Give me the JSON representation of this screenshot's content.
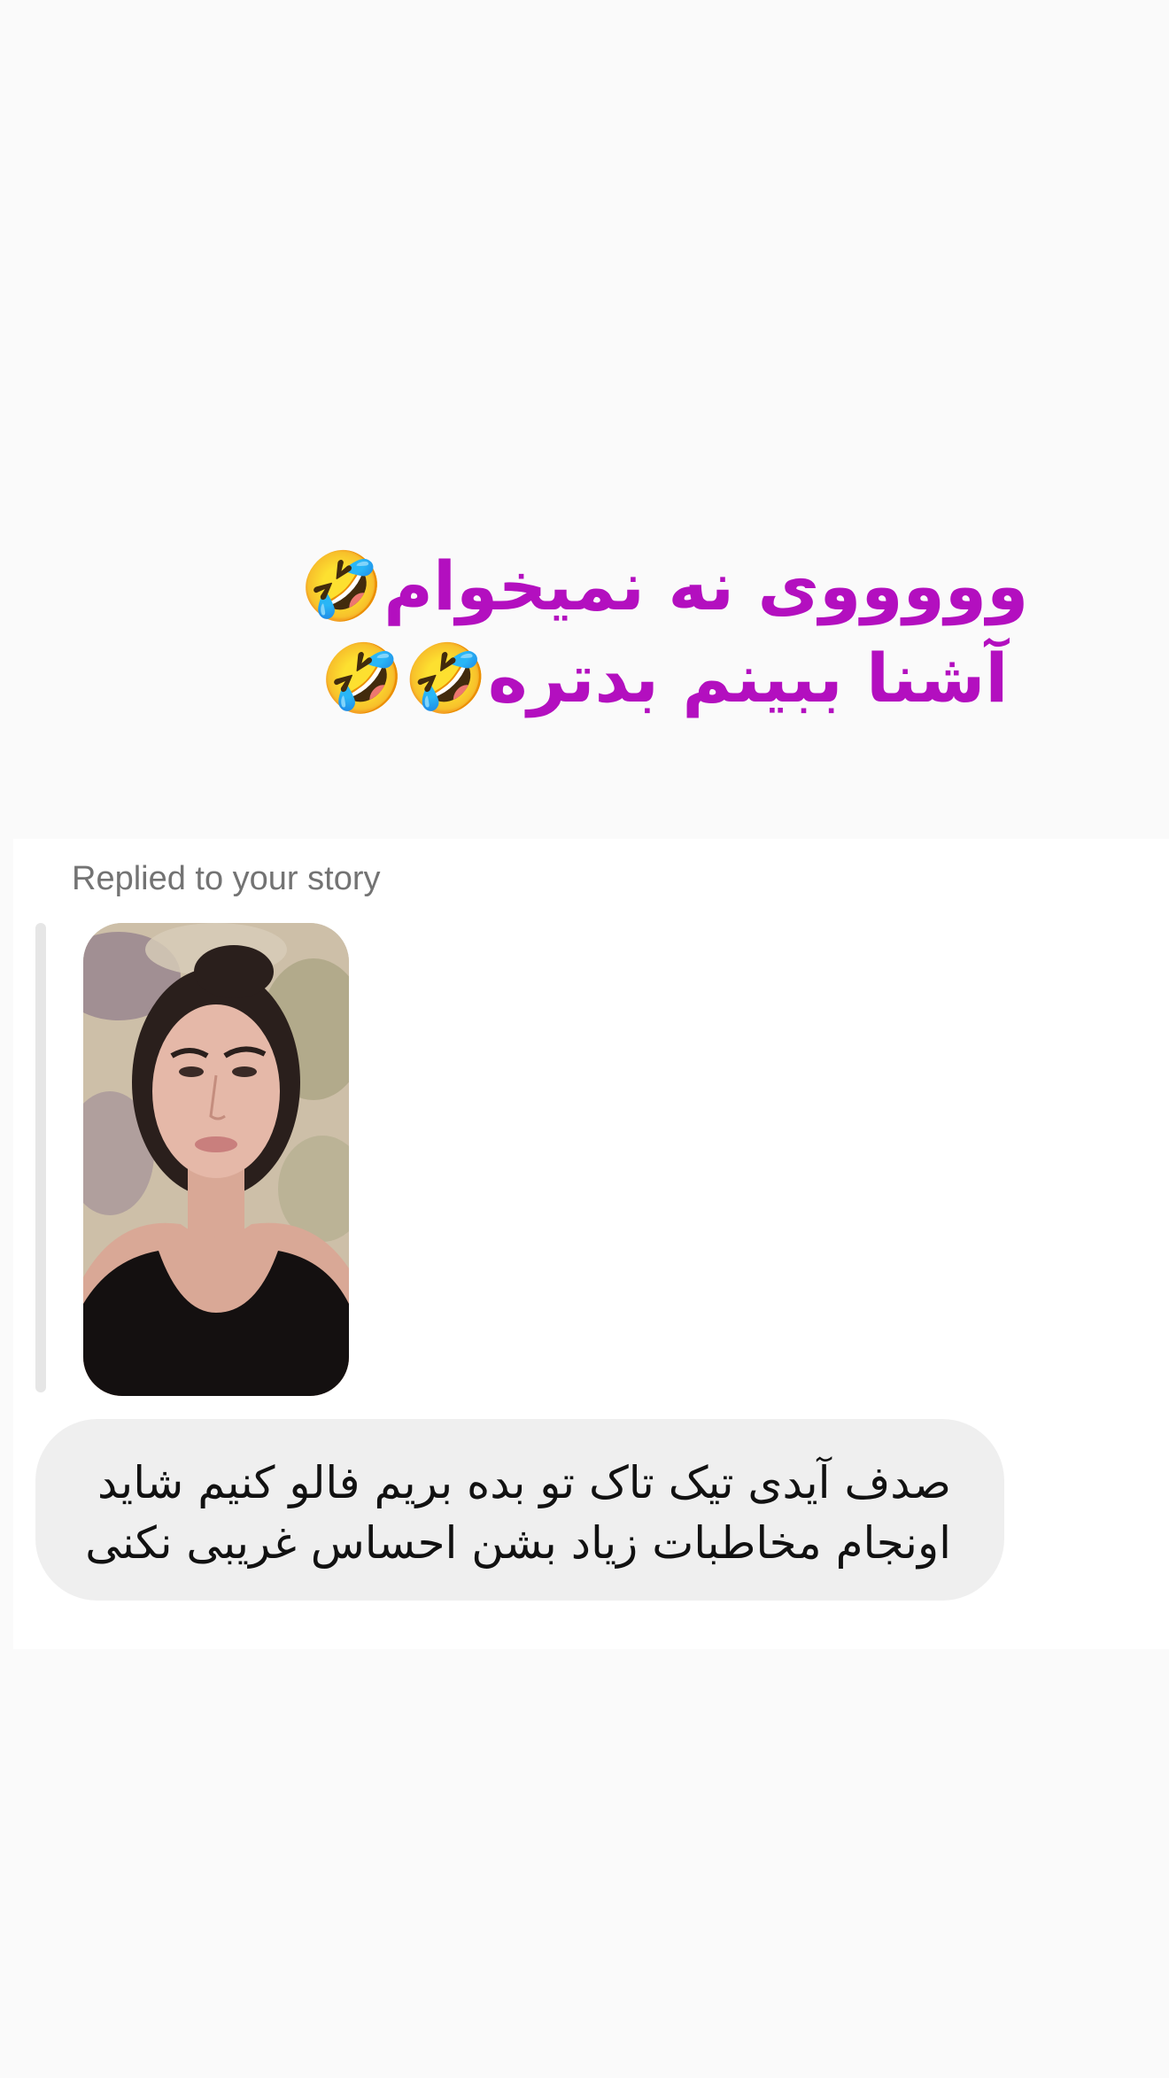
{
  "story_overlay": {
    "line1": "وووووی نه نمیخوام🤣",
    "line2": "آشنا ببینم بدتره🤣🤣",
    "color": "#b30fbf"
  },
  "chat": {
    "reply_caption": "Replied to your story",
    "story_thumbnail": "story-photo",
    "message": {
      "line1": "صدف آیدی تیک تاک تو بده بریم فالو کنیم شاید",
      "line2": "اونجام مخاطبات زیاد بشن احساس غریبی نکنی"
    }
  },
  "colors": {
    "background": "#fafafa",
    "card": "#ffffff",
    "bubble": "#efefef",
    "caption": "#737373"
  }
}
